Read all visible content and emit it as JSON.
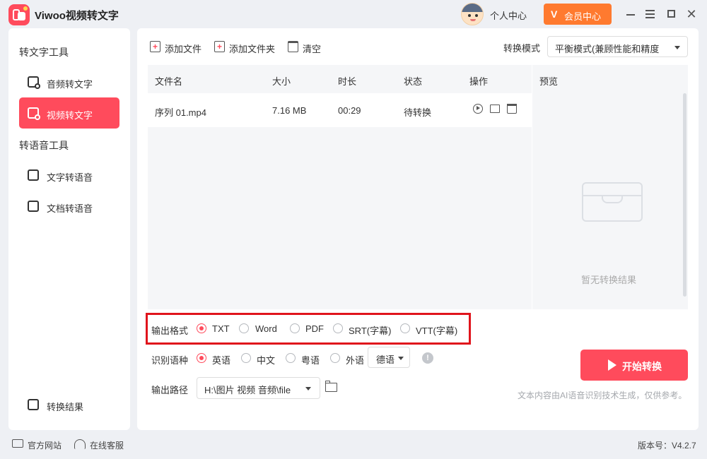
{
  "app": {
    "title": "Viwoo视频转文字"
  },
  "header": {
    "personal": "个人中心",
    "vip": "会员中心"
  },
  "sidebar": {
    "sections": [
      "转文字工具",
      "转语音工具"
    ],
    "items": [
      {
        "label": "音频转文字",
        "icon": "audio-to-text-icon"
      },
      {
        "label": "视频转文字",
        "icon": "video-to-text-icon",
        "active": true
      },
      {
        "label": "文字转语音",
        "icon": "text-to-speech-icon"
      },
      {
        "label": "文档转语音",
        "icon": "document-to-speech-icon"
      }
    ],
    "result": "转换结果"
  },
  "toolbar": {
    "add_file": "添加文件",
    "add_folder": "添加文件夹",
    "clear": "清空",
    "mode_label": "转换模式",
    "mode_value": "平衡模式(兼顾性能和精度"
  },
  "table": {
    "headers": [
      "文件名",
      "大小",
      "时长",
      "状态",
      "操作"
    ],
    "rows": [
      {
        "name": "序列 01.mp4",
        "size": "7.16 MB",
        "duration": "00:29",
        "status": "待转换"
      }
    ]
  },
  "preview": {
    "title": "预览",
    "empty": "暂无转换结果"
  },
  "format": {
    "label": "输出格式",
    "options": [
      "TXT",
      "Word",
      "PDF",
      "SRT(字幕)",
      "VTT(字幕)"
    ],
    "selected": "TXT"
  },
  "language": {
    "label": "识别语种",
    "options": [
      "英语",
      "中文",
      "粤语",
      "外语"
    ],
    "selected": "英语",
    "foreign_value": "德语"
  },
  "output": {
    "label": "输出路径",
    "path": "H:\\图片 视频 音频\\file"
  },
  "start_button": "开始转换",
  "disclaimer": "文本内容由AI语音识别技术生成，仅供参考。",
  "footer": {
    "website": "官方网站",
    "support": "在线客服",
    "version": "版本号：V4.2.7"
  },
  "colors": {
    "accent": "#ff4b5c",
    "vip": "#ff7a2f",
    "highlight": "#e0141c"
  }
}
